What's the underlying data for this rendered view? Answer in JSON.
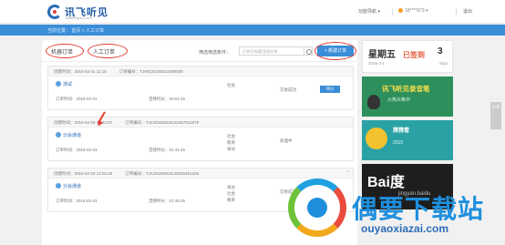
{
  "header": {
    "logo_text": "讯飞听见",
    "logo_sub": "www.iflyrec.com",
    "func_nav": "功能导航 ▾",
    "phone": "18****873 ▾",
    "logout": "退出"
  },
  "breadcrumb": "当前位置： 首页 > 人工订单",
  "tabs": {
    "machine": "机器订单",
    "manual": "人工订单"
  },
  "filter": {
    "label": "筛选筛选条件：",
    "placeholder": "订单号/标题/音频名称",
    "new_order": "+ 新建订单"
  },
  "orders": [
    {
      "created": "创建时间：2016-03-31 11:18",
      "order_no": "订单编号：TJWG20160311090008",
      "name": "测试",
      "date": "订单时间：2016-03-31",
      "duration": "音频时长：00:01:45",
      "tags": [
        "社会"
      ],
      "status": "交易成功",
      "action": "评价",
      "close": ""
    },
    {
      "created": "创建时间：2016-02-03 14:24:57",
      "order_no": "订单编号：TJC20160203142457814579",
      "name": "分会通道",
      "date": "订单时间：2016-02-03",
      "duration": "音频时长：01:41:45",
      "tags": [
        "社会",
        "教育",
        "采访"
      ],
      "status": "处理中",
      "action": "",
      "close": ""
    },
    {
      "created": "创建时间：2016-02-03 14:02:26",
      "order_no": "订单编号：TJC20160203140226461226",
      "name": "分会通道",
      "date": "订单时间：2016-02-03",
      "duration": "音频时长：01:49:25",
      "tags": [
        "采访",
        "社会",
        "教育"
      ],
      "status": "交易成功",
      "action": "",
      "close": "×"
    }
  ],
  "sidebar": {
    "weekday": "星期五",
    "date": "2016-4-1",
    "signed": "已签到",
    "days": "3",
    "days_unit": "days",
    "banner1_title": "讯飞听见录音笔",
    "banner1_sub": "火热众筹中",
    "banner2_title": "猜猜看",
    "banner2_sub": "2015",
    "banner3_title": "Bai度",
    "banner3_sub": "jingyan.baidu"
  },
  "share": "分享",
  "watermark": {
    "text": "偶要下载站",
    "url": "ouyaoxiazai.com"
  },
  "colors": {
    "accent": "#3a8ed8",
    "annotation": "#e23b2f"
  }
}
